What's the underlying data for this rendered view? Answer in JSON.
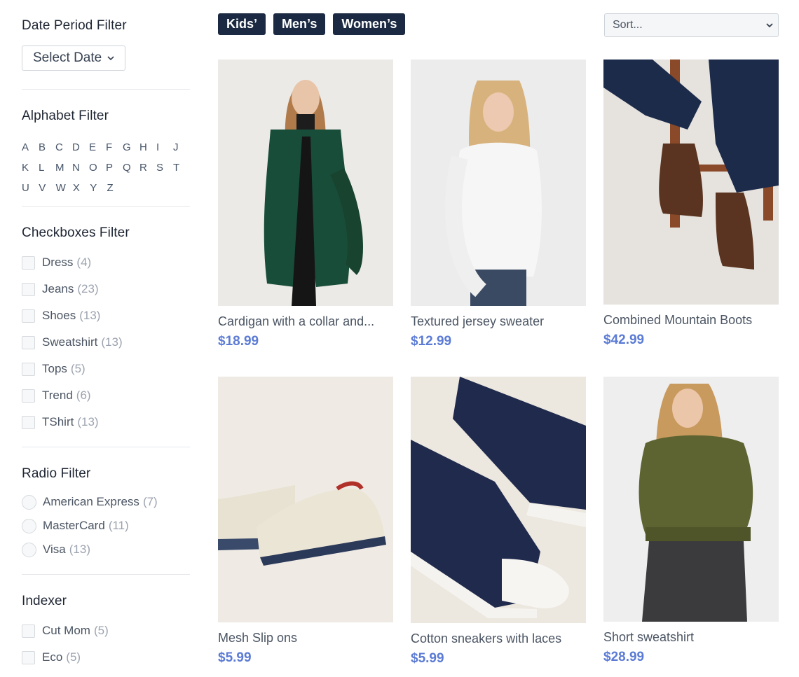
{
  "sidebar": {
    "date_filter": {
      "title": "Date Period Filter",
      "select_label": "Select Date"
    },
    "alphabet_filter": {
      "title": "Alphabet Filter",
      "rows": [
        [
          "A",
          "B",
          "C",
          "D",
          "E",
          "F",
          "G",
          "H",
          "I",
          "J"
        ],
        [
          "K",
          "L",
          "M",
          "N",
          "O",
          "P",
          "Q",
          "R",
          "S",
          "T"
        ],
        [
          "U",
          "V",
          "W",
          "X",
          "Y",
          "Z"
        ]
      ]
    },
    "checkbox_filter": {
      "title": "Checkboxes Filter",
      "items": [
        {
          "label": "Dress",
          "count": "(4)"
        },
        {
          "label": "Jeans",
          "count": "(23)"
        },
        {
          "label": "Shoes",
          "count": "(13)"
        },
        {
          "label": "Sweatshirt",
          "count": "(13)"
        },
        {
          "label": "Tops",
          "count": "(5)"
        },
        {
          "label": "Trend",
          "count": "(6)"
        },
        {
          "label": "TShirt",
          "count": "(13)"
        }
      ]
    },
    "radio_filter": {
      "title": "Radio Filter",
      "items": [
        {
          "label": "American Express",
          "count": "(7)"
        },
        {
          "label": "MasterCard",
          "count": "(11)"
        },
        {
          "label": "Visa",
          "count": "(13)"
        }
      ]
    },
    "indexer": {
      "title": "Indexer",
      "items": [
        {
          "label": "Cut Mom",
          "count": "(5)"
        },
        {
          "label": "Eco",
          "count": "(5)"
        }
      ]
    }
  },
  "toolbar": {
    "tags": [
      "Kids’",
      "Men’s",
      "Women’s"
    ],
    "sort_placeholder": "Sort..."
  },
  "products": [
    {
      "name": "Cardigan with a collar and...",
      "price": "$18.99",
      "image": "woman-green-cardigan"
    },
    {
      "name": "Textured jersey sweater",
      "price": "$12.99",
      "image": "woman-white-sweater"
    },
    {
      "name": "Combined Mountain Boots",
      "price": "$42.99",
      "image": "brown-leather-boots"
    },
    {
      "name": "Mesh Slip ons",
      "price": "$5.99",
      "image": "mesh-slip-on-shoes"
    },
    {
      "name": "Cotton sneakers with laces",
      "price": "$5.99",
      "image": "navy-canvas-sneakers"
    },
    {
      "name": "Short sweatshirt",
      "price": "$28.99",
      "image": "woman-olive-sweatshirt"
    }
  ],
  "colors": {
    "tag_bg": "#1b2a42",
    "price": "#5b7bd5",
    "text": "#4b5563",
    "count": "#9ca3af"
  }
}
